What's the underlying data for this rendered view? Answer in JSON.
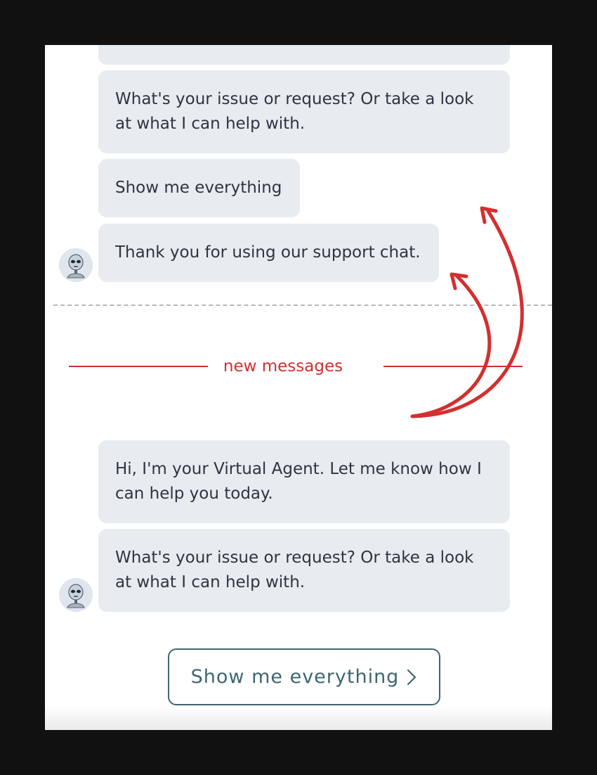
{
  "chat": {
    "earlier_messages": [
      {
        "text": "What's your issue or request? Or take a look at what I can help with."
      },
      {
        "text": "Show me everything"
      },
      {
        "text": "Thank you for using our support chat."
      }
    ],
    "separator_label": "new messages",
    "new_messages": [
      {
        "text": "Hi, I'm your Virtual Agent. Let me know how I can help you today."
      },
      {
        "text": "What's your issue or request? Or take a look at what I can help with."
      }
    ],
    "quick_reply": {
      "label": "Show me everything",
      "icon": "chevron-right-icon"
    },
    "avatar_icon": "robot-avatar-icon"
  },
  "colors": {
    "page_background": "#111111",
    "panel_background": "#ffffff",
    "bubble_background": "#e8ebf0",
    "bubble_text": "#2e3440",
    "accent_red": "#d32f2f",
    "button_border": "#3e6672"
  }
}
